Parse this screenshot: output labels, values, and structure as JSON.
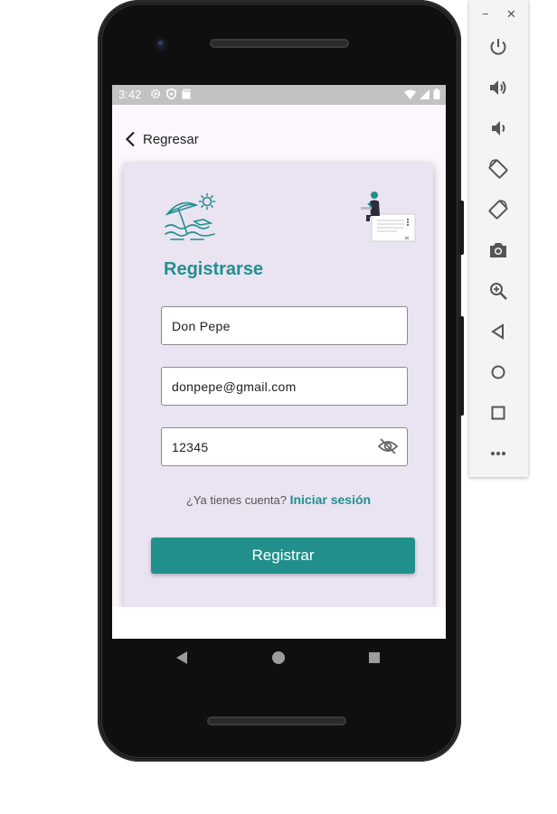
{
  "status_bar": {
    "time": "3:42"
  },
  "header": {
    "back_label": "Regresar"
  },
  "form": {
    "title": "Registrarse",
    "name_value": "Don Pepe",
    "email_value": "donpepe@gmail.com",
    "password_value": "12345",
    "login_prompt": "¿Ya tienes cuenta?",
    "login_link": "Iniciar sesión",
    "submit_label": "Registrar"
  },
  "emulator": {
    "minimize_glyph": "−",
    "close_glyph": "✕",
    "buttons": [
      "power-icon",
      "volume-up-icon",
      "volume-down-icon",
      "rotate-left-icon",
      "rotate-right-icon",
      "camera-icon",
      "zoom-icon",
      "back-icon",
      "home-icon",
      "overview-icon",
      "more-icon"
    ]
  },
  "colors": {
    "accent": "#21908c",
    "card": "#e9e3f2",
    "status_bar": "#c2c2c2"
  }
}
